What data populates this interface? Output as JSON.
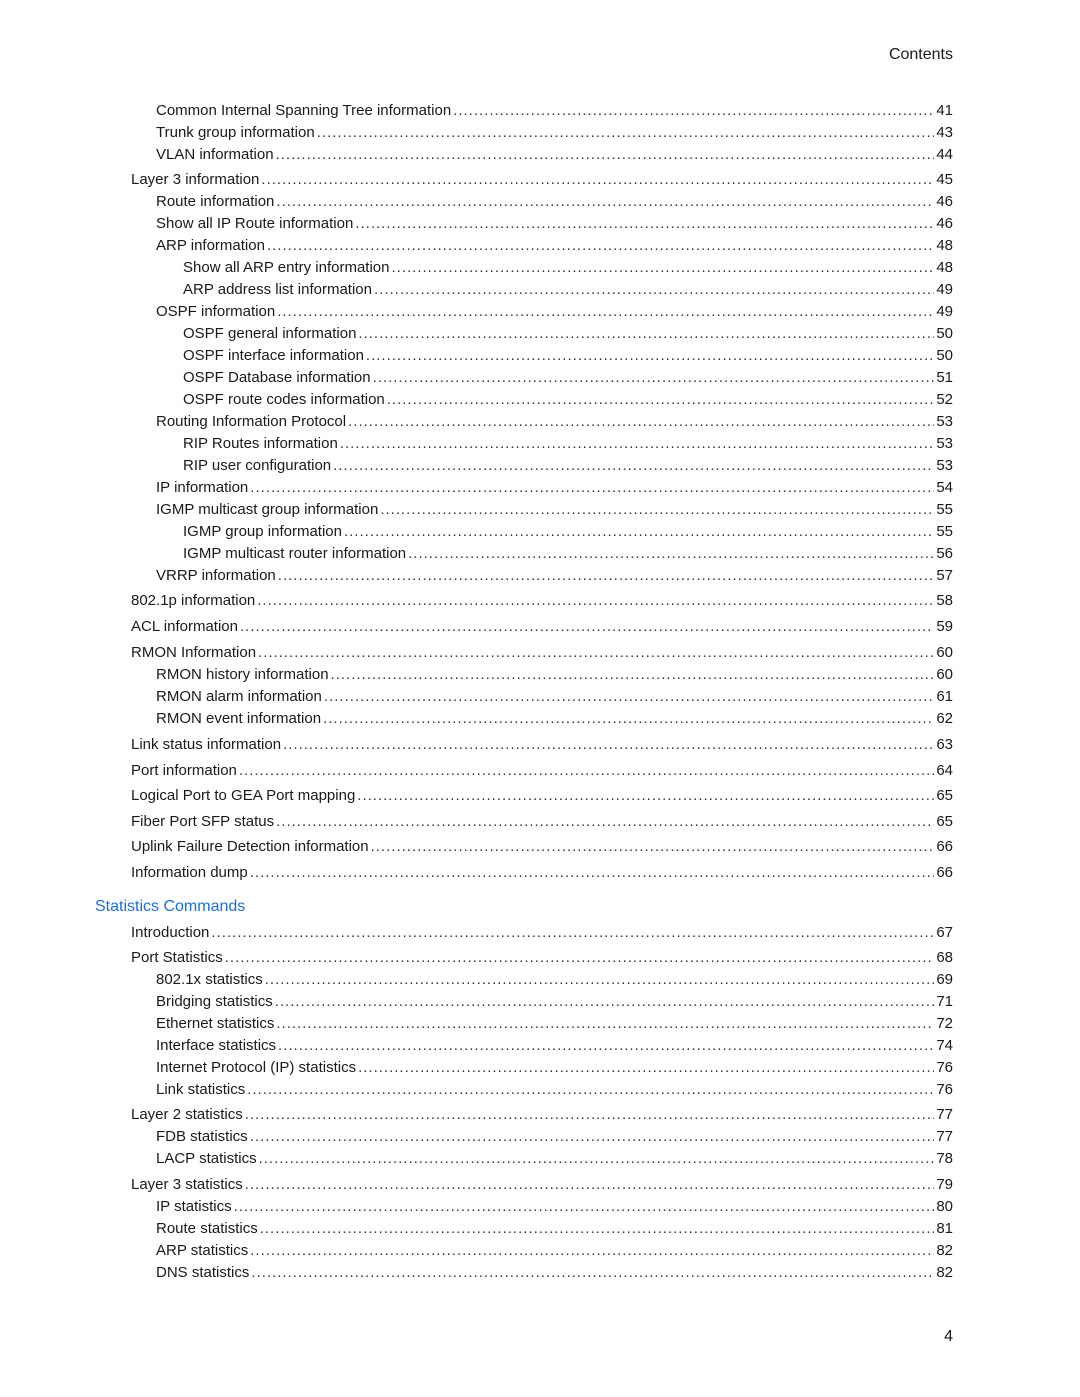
{
  "header": {
    "title": "Contents"
  },
  "entries_top": [
    {
      "level": 1,
      "title": "Common Internal Spanning Tree information",
      "page": "41"
    },
    {
      "level": 1,
      "title": "Trunk group information",
      "page": "43"
    },
    {
      "level": 1,
      "title": "VLAN information",
      "page": "44"
    },
    {
      "level": 0,
      "title": "Layer 3 information",
      "page": "45"
    },
    {
      "level": 1,
      "title": "Route information",
      "page": "46"
    },
    {
      "level": 1,
      "title": "Show all IP Route information",
      "page": "46"
    },
    {
      "level": 1,
      "title": "ARP information",
      "page": "48"
    },
    {
      "level": 2,
      "title": "Show all ARP entry information",
      "page": "48"
    },
    {
      "level": 2,
      "title": "ARP address list information",
      "page": "49"
    },
    {
      "level": 1,
      "title": "OSPF information",
      "page": "49"
    },
    {
      "level": 2,
      "title": "OSPF general information",
      "page": "50"
    },
    {
      "level": 2,
      "title": "OSPF interface information",
      "page": "50"
    },
    {
      "level": 2,
      "title": "OSPF Database information",
      "page": "51"
    },
    {
      "level": 2,
      "title": "OSPF route codes information",
      "page": "52"
    },
    {
      "level": 1,
      "title": "Routing Information Protocol",
      "page": "53"
    },
    {
      "level": 2,
      "title": "RIP Routes information",
      "page": "53"
    },
    {
      "level": 2,
      "title": "RIP user configuration",
      "page": "53"
    },
    {
      "level": 1,
      "title": "IP information",
      "page": "54"
    },
    {
      "level": 1,
      "title": "IGMP multicast group information",
      "page": "55"
    },
    {
      "level": 2,
      "title": "IGMP group information",
      "page": "55"
    },
    {
      "level": 2,
      "title": "IGMP multicast router information",
      "page": "56"
    },
    {
      "level": 1,
      "title": "VRRP information",
      "page": "57"
    },
    {
      "level": 0,
      "title": "802.1p information",
      "page": "58"
    },
    {
      "level": 0,
      "title": "ACL information",
      "page": "59"
    },
    {
      "level": 0,
      "title": "RMON Information",
      "page": "60"
    },
    {
      "level": 1,
      "title": "RMON history information",
      "page": "60"
    },
    {
      "level": 1,
      "title": "RMON alarm information",
      "page": "61"
    },
    {
      "level": 1,
      "title": "RMON event information",
      "page": "62"
    },
    {
      "level": 0,
      "title": "Link status information",
      "page": "63"
    },
    {
      "level": 0,
      "title": "Port information",
      "page": "64"
    },
    {
      "level": 0,
      "title": "Logical Port to GEA Port mapping",
      "page": "65"
    },
    {
      "level": 0,
      "title": "Fiber Port SFP status",
      "page": "65"
    },
    {
      "level": 0,
      "title": "Uplink Failure Detection information",
      "page": "66"
    },
    {
      "level": 0,
      "title": "Information dump",
      "page": "66"
    }
  ],
  "section": {
    "title": "Statistics Commands",
    "color": "#1a6fe0"
  },
  "entries_bottom": [
    {
      "level": 0,
      "title": "Introduction",
      "page": "67"
    },
    {
      "level": 0,
      "title": "Port Statistics",
      "page": "68"
    },
    {
      "level": 1,
      "title": "802.1x statistics",
      "page": "69"
    },
    {
      "level": 1,
      "title": "Bridging statistics",
      "page": "71"
    },
    {
      "level": 1,
      "title": "Ethernet statistics",
      "page": "72"
    },
    {
      "level": 1,
      "title": "Interface statistics",
      "page": "74"
    },
    {
      "level": 1,
      "title": "Internet Protocol (IP) statistics",
      "page": "76"
    },
    {
      "level": 1,
      "title": "Link statistics",
      "page": "76"
    },
    {
      "level": 0,
      "title": "Layer 2 statistics",
      "page": "77"
    },
    {
      "level": 1,
      "title": "FDB statistics",
      "page": "77"
    },
    {
      "level": 1,
      "title": "LACP statistics",
      "page": "78"
    },
    {
      "level": 0,
      "title": "Layer 3 statistics",
      "page": "79"
    },
    {
      "level": 1,
      "title": "IP statistics",
      "page": "80"
    },
    {
      "level": 1,
      "title": "Route statistics",
      "page": "81"
    },
    {
      "level": 1,
      "title": "ARP statistics",
      "page": "82"
    },
    {
      "level": 1,
      "title": "DNS statistics",
      "page": "82"
    }
  ],
  "footer": {
    "page_number": "4"
  }
}
